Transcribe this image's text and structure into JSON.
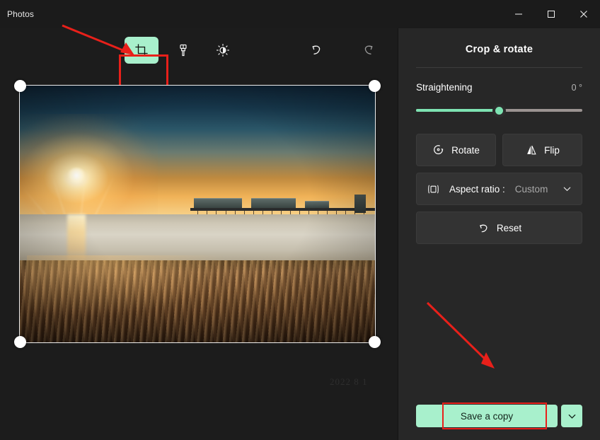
{
  "window": {
    "app_title": "Photos",
    "caption_buttons": [
      {
        "name": "minimize",
        "label": "Minimize"
      },
      {
        "name": "maximize",
        "label": "Maximize"
      },
      {
        "name": "close",
        "label": "Close"
      }
    ]
  },
  "toolbar": {
    "tools": [
      {
        "name": "crop-rotate",
        "label": "Crop & rotate",
        "selected": true
      },
      {
        "name": "markup",
        "label": "Markup",
        "selected": false
      },
      {
        "name": "adjustment",
        "label": "Adjustment",
        "selected": false
      }
    ],
    "history": [
      {
        "name": "undo",
        "label": "Undo",
        "enabled": true
      },
      {
        "name": "redo",
        "label": "Redo",
        "enabled": false
      }
    ]
  },
  "canvas": {
    "image_description": "Sunset over a beach with a long pier and rippled wet sand",
    "watermark": "2022 8 1",
    "crop_handles": [
      "top-left",
      "top-right",
      "bottom-left",
      "bottom-right"
    ]
  },
  "panel": {
    "title": "Crop & rotate",
    "straightening": {
      "label": "Straightening",
      "value": "0 °",
      "slider_percent": 50
    },
    "rotate_label": "Rotate",
    "flip_label": "Flip",
    "aspect_ratio": {
      "label": "Aspect ratio :",
      "value": "Custom"
    },
    "reset_label": "Reset",
    "save_label": "Save a copy"
  },
  "colors": {
    "accent_mint": "#a8f0cc",
    "slider_fill": "#7ee3b2",
    "highlight_red": "#e8201a",
    "panel_bg": "#272727",
    "canvas_bg": "#1c1c1c"
  },
  "annotations": [
    {
      "name": "arrow-to-crop-tool",
      "target": "crop-rotate tool button"
    },
    {
      "name": "arrow-to-save-button",
      "target": "Save a copy button"
    }
  ]
}
